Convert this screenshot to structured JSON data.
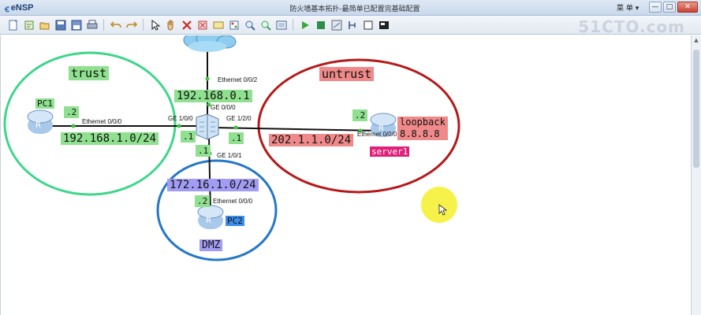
{
  "window": {
    "app_name": "eNSP",
    "title": "防火墙基本拓扑-最简单已配置完基础配置",
    "menu_label": "菜 单 ▾",
    "minimize": "—",
    "maximize": "□",
    "close": "✕"
  },
  "toolbar": {
    "buttons": [
      "new-topology",
      "new-from-template",
      "open",
      "save",
      "save-as",
      "print",
      "undo",
      "redo",
      "select",
      "pan",
      "delete",
      "delete-link",
      "text",
      "palette",
      "zoom-in",
      "zoom-out",
      "fit",
      "start-device",
      "stop-device",
      "capture",
      "topology-grid",
      "console",
      "fullscreen"
    ]
  },
  "watermark": "51CTO.com",
  "zones": {
    "trust": "trust",
    "untrust": "untrust",
    "dmz": "DMZ"
  },
  "devices": {
    "pc1": {
      "name": "PC1",
      "addr": ".2",
      "port": "Ethernet 0/0/0"
    },
    "pc2": {
      "name": "PC2",
      "addr": ".2",
      "port": "Ethernet 0/0/0"
    },
    "server1": {
      "name": "server1",
      "addr": ".2",
      "port": "Ethernet 0/0/0",
      "loopback_label": "loopback",
      "loopback_ip": "8.8.8.8"
    },
    "cloud": {
      "port": "Ethernet 0/0/2"
    },
    "firewall": {
      "g000_port": "GE 0/0/0",
      "g100_port": "GE 1/0/0",
      "g120_port": "GE 1/2/0",
      "g101_port": "GE 1/0/1",
      "left_addr": ".1",
      "right_addr": ".1",
      "down_addr": ".1"
    }
  },
  "networks": {
    "mgmt": "192.168.0.1",
    "trust": "192.168.1.0/24",
    "untrust": "202.1.1.0/24",
    "dmz": "172.16.1.0/24"
  }
}
